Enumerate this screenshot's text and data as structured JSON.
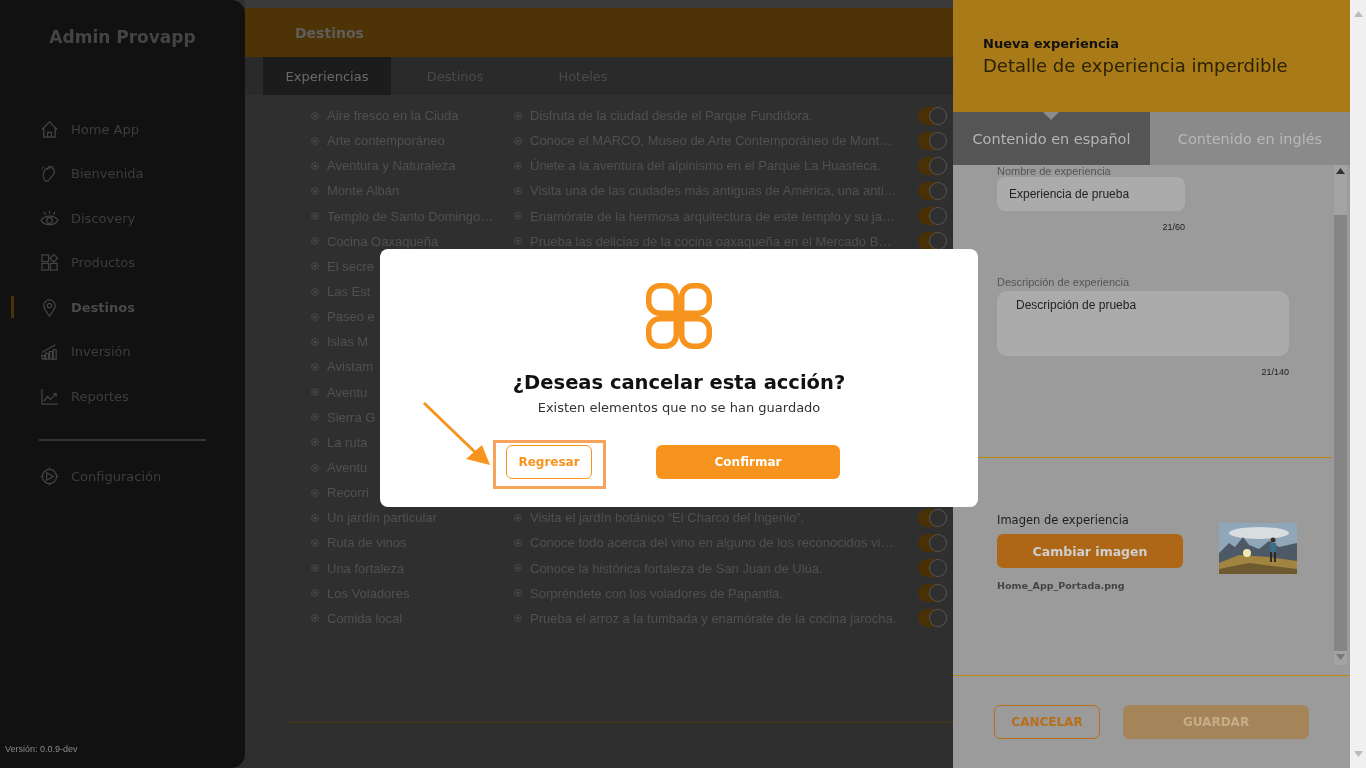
{
  "sidebar": {
    "title": "Admin Provapp",
    "items": [
      {
        "label": "Home App",
        "selected": false
      },
      {
        "label": "Bienvenida",
        "selected": false
      },
      {
        "label": "Discovery",
        "selected": false
      },
      {
        "label": "Productos",
        "selected": false
      },
      {
        "label": "Destinos",
        "selected": true
      },
      {
        "label": "Inversión",
        "selected": false
      },
      {
        "label": "Reportes",
        "selected": false
      }
    ],
    "settings": {
      "label": "Configuración"
    },
    "version": "Versión: 0.0.9-dev"
  },
  "header": {
    "title": "Destinos"
  },
  "tabs": [
    {
      "label": "Experiencias",
      "selected": true
    },
    {
      "label": "Destinos",
      "selected": false
    },
    {
      "label": "Hoteles",
      "selected": false
    }
  ],
  "table": {
    "rows": [
      {
        "name": "Aire fresco en la Ciuda",
        "description": "Disfruta de la ciudad desde el Parque Fundidora.",
        "on": true
      },
      {
        "name": "Arte contemporáneo",
        "description": "Conoce el MARCO, Museo de Arte Contemporáneo de Mont…",
        "on": true
      },
      {
        "name": "Aventura y Naturaleza",
        "description": "Únete a la aventura del alpinismo en el Parque La Huasteca.",
        "on": true
      },
      {
        "name": "Monte Albán",
        "description": "Visita una de las ciudades más antiguas de América, una anti…",
        "on": true
      },
      {
        "name": "Templo de Santo Domingo…",
        "description": "Enamórate de la hermosa arquitectura de este templo y su ja…",
        "on": true
      },
      {
        "name": "Cocina Oaxaqueña",
        "description": "Prueba las delicias de la cocina oaxaqueña en el Mercado B…",
        "on": true
      },
      {
        "name": "El secre"
      },
      {
        "name": "Las Est"
      },
      {
        "name": "Paseo e"
      },
      {
        "name": "Islas M"
      },
      {
        "name": "Avistam"
      },
      {
        "name": "Aventu"
      },
      {
        "name": "Sierra G"
      },
      {
        "name": "La ruta"
      },
      {
        "name": "Aventu"
      },
      {
        "name": "Recorri"
      },
      {
        "name": "Un jardín particular",
        "description": "Visita el jardín botánico “El Charco del Ingenio”.",
        "on": true
      },
      {
        "name": "Ruta de vinos",
        "description": "Conoce todo acerca del vino en alguno de los reconocidos vi…",
        "on": true
      },
      {
        "name": "Una fortaleza",
        "description": "Conoce la histórica fortaleza de San Juan de Ulúa.",
        "on": true
      },
      {
        "name": "Los Voladores",
        "description": "Sorpréndete con los voladores de Papantla.",
        "on": true
      },
      {
        "name": "Comida local",
        "description": "Prueba el arroz a la tumbada y enamórate de la cocina jarocha.",
        "on": true
      }
    ]
  },
  "drawer": {
    "title": "Nueva experiencia",
    "subtitle": "Detalle de experiencia imperdible",
    "tabs": [
      {
        "label": "Contenido en español",
        "selected": true
      },
      {
        "label": "Contenido en inglés",
        "selected": false
      }
    ],
    "name_field": {
      "label": "Nombre de experiencia",
      "value": "Experiencia de prueba",
      "counter": "21/60"
    },
    "description_field": {
      "label": "Descripción de experiencia",
      "value": "Descripción de prueba",
      "counter": "21/140"
    },
    "image": {
      "label": "Imagen de experiencia",
      "button": "Cambiar imagen",
      "filename": "Home_App_Portada.png"
    },
    "buttons": [
      {
        "label": "CANCELAR",
        "kind": "outline",
        "disabled": false
      },
      {
        "label": "GUARDAR",
        "kind": "filled",
        "disabled": true
      }
    ]
  },
  "dialog": {
    "title": "¿Deseas cancelar esta acción?",
    "message": "Existen elementos que no se han guardado",
    "buttons": [
      {
        "label": "Regresar",
        "kind": "outline",
        "highlighted": true
      },
      {
        "label": "Confirmar",
        "kind": "filled",
        "highlighted": false
      }
    ]
  }
}
